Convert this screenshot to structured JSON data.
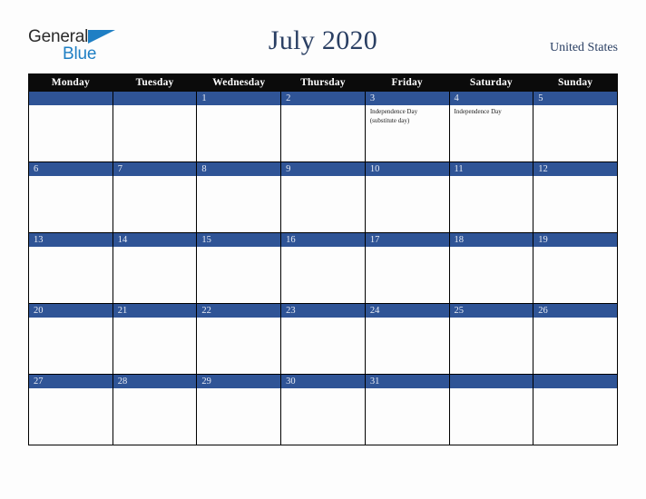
{
  "header": {
    "logo": {
      "line1": "General",
      "line2": "Blue",
      "triangle_color": "#1f7fc4",
      "text_color": "#2b2b2b"
    },
    "title": "July 2020",
    "country": "United States",
    "title_color": "#2a3f63"
  },
  "calendar": {
    "accent_color": "#2f5496",
    "header_bg": "#0b0b0b",
    "weekday_headers": [
      "Monday",
      "Tuesday",
      "Wednesday",
      "Thursday",
      "Friday",
      "Saturday",
      "Sunday"
    ],
    "weeks": [
      [
        {
          "day": "",
          "events": []
        },
        {
          "day": "",
          "events": []
        },
        {
          "day": "1",
          "events": []
        },
        {
          "day": "2",
          "events": []
        },
        {
          "day": "3",
          "events": [
            "Independence Day (substitute day)"
          ]
        },
        {
          "day": "4",
          "events": [
            "Independence Day"
          ]
        },
        {
          "day": "5",
          "events": []
        }
      ],
      [
        {
          "day": "6",
          "events": []
        },
        {
          "day": "7",
          "events": []
        },
        {
          "day": "8",
          "events": []
        },
        {
          "day": "9",
          "events": []
        },
        {
          "day": "10",
          "events": []
        },
        {
          "day": "11",
          "events": []
        },
        {
          "day": "12",
          "events": []
        }
      ],
      [
        {
          "day": "13",
          "events": []
        },
        {
          "day": "14",
          "events": []
        },
        {
          "day": "15",
          "events": []
        },
        {
          "day": "16",
          "events": []
        },
        {
          "day": "17",
          "events": []
        },
        {
          "day": "18",
          "events": []
        },
        {
          "day": "19",
          "events": []
        }
      ],
      [
        {
          "day": "20",
          "events": []
        },
        {
          "day": "21",
          "events": []
        },
        {
          "day": "22",
          "events": []
        },
        {
          "day": "23",
          "events": []
        },
        {
          "day": "24",
          "events": []
        },
        {
          "day": "25",
          "events": []
        },
        {
          "day": "26",
          "events": []
        }
      ],
      [
        {
          "day": "27",
          "events": []
        },
        {
          "day": "28",
          "events": []
        },
        {
          "day": "29",
          "events": []
        },
        {
          "day": "30",
          "events": []
        },
        {
          "day": "31",
          "events": []
        },
        {
          "day": "",
          "events": []
        },
        {
          "day": "",
          "events": []
        }
      ]
    ]
  }
}
